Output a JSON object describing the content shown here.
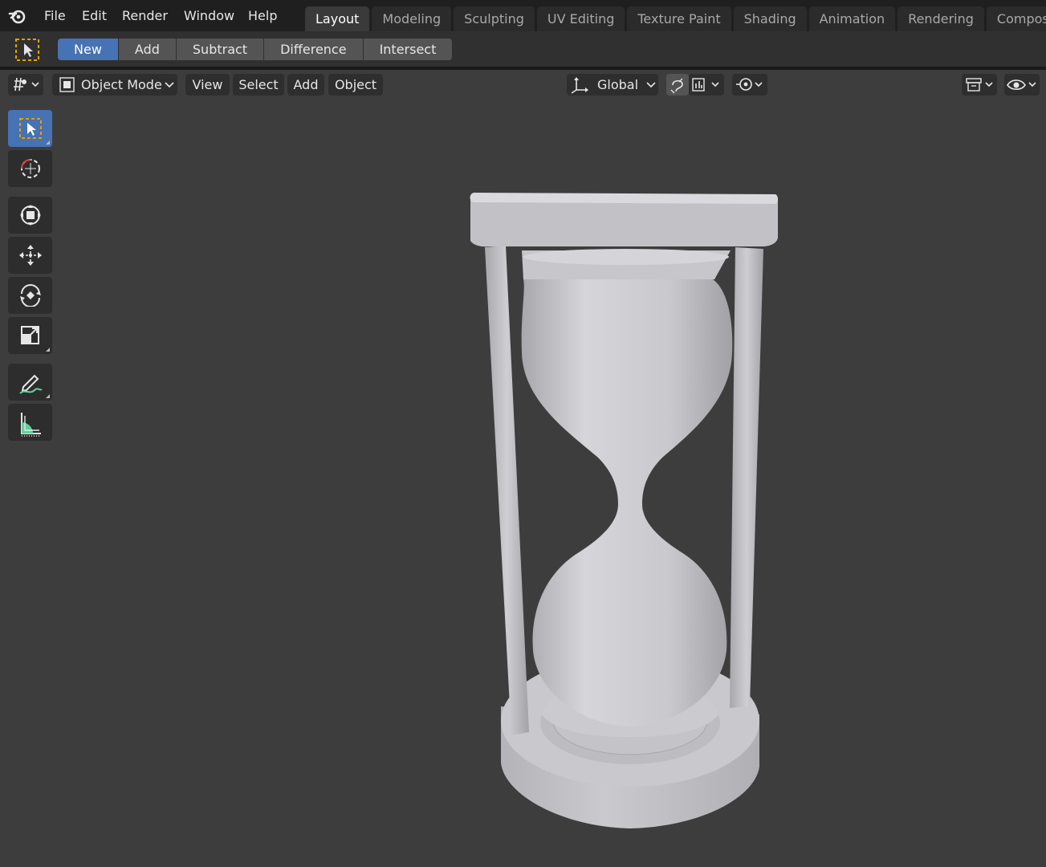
{
  "app": {
    "logo_icon": "blender-logo-icon"
  },
  "menus": [
    "File",
    "Edit",
    "Render",
    "Window",
    "Help"
  ],
  "workspace_tabs": [
    {
      "label": "Layout",
      "active": true
    },
    {
      "label": "Modeling",
      "active": false
    },
    {
      "label": "Sculpting",
      "active": false
    },
    {
      "label": "UV Editing",
      "active": false
    },
    {
      "label": "Texture Paint",
      "active": false
    },
    {
      "label": "Shading",
      "active": false
    },
    {
      "label": "Animation",
      "active": false
    },
    {
      "label": "Rendering",
      "active": false
    },
    {
      "label": "Compositing",
      "active": false
    }
  ],
  "tool_header": {
    "mode_buttons": [
      "New",
      "Add",
      "Subtract",
      "Difference",
      "Intersect"
    ],
    "selected_mode": "New"
  },
  "viewport_header": {
    "interaction_mode": "Object Mode",
    "menus": [
      "View",
      "Select",
      "Add",
      "Object"
    ],
    "transform_orientation": "Global"
  },
  "toolbar": {
    "tools": [
      "select-box",
      "cursor",
      "transform",
      "move",
      "rotate",
      "scale",
      "annotate",
      "measure"
    ],
    "active_tool": "select-box"
  },
  "colors": {
    "accent": "#4772b3",
    "background": "#3d3d3d",
    "topbar": "#1f1f1f"
  }
}
